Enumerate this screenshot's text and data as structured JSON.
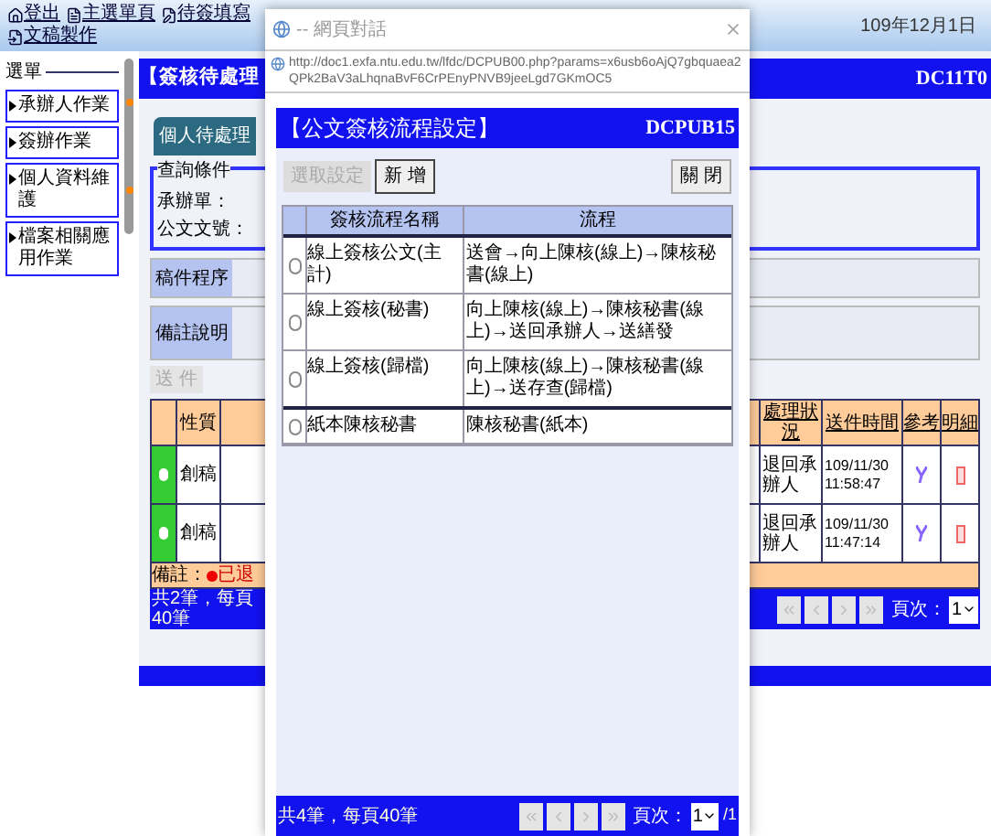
{
  "top_nav": {
    "links": [
      {
        "label": "登出"
      },
      {
        "label": "主選單頁"
      },
      {
        "label": "待簽填寫"
      },
      {
        "label": "文稿製作"
      }
    ],
    "date": "109年12月1日"
  },
  "sidebar": {
    "title": "選單",
    "items": [
      {
        "label": "承辦人作業"
      },
      {
        "label": "簽辦作業"
      },
      {
        "label": "個人資料維護"
      },
      {
        "label": "檔案相關應用作業"
      }
    ]
  },
  "page": {
    "title": "【簽核待處理",
    "code": "DC11T0",
    "tabs": [
      {
        "label": "個人待處理",
        "selected": true
      }
    ],
    "query": {
      "legend": "查詢條件",
      "fields": [
        {
          "label": "承辦單："
        },
        {
          "label": "公文文號："
        }
      ]
    },
    "sort_label": "稿件程序",
    "remark_label": "備註說明",
    "buttons": [
      {
        "label": "送 件"
      }
    ],
    "table": {
      "columns_left": [
        "性質"
      ],
      "columns_right": [
        "處理狀況",
        "送件時間",
        "參考",
        "明細"
      ],
      "rows": [
        {
          "nature": "創稿",
          "status": "退回承辦人",
          "time": "109/11/30 11:58:47"
        },
        {
          "nature": "創稿",
          "status": "退回承辦人",
          "time": "109/11/30 11:47:14"
        }
      ]
    },
    "note": "備註：",
    "note_text": "已退",
    "pager": {
      "summary": "共2筆，每頁40筆",
      "page_label": "頁次：",
      "page": "1"
    }
  },
  "dialog": {
    "title": "-- 網頁對話",
    "url": "http://doc1.exfa.ntu.edu.tw/lfdc/DCPUB00.php?params=x6usb6oAjQ7gbquaea2QPk2BaV3aLhqnaBvF6CrPEnyPNVB9jeeLgd7GKmOC5",
    "heading": "【公文簽核流程設定】",
    "code": "DCPUB15",
    "buttons": [
      {
        "label": "選取設定",
        "disabled": true
      },
      {
        "label": "新 增",
        "disabled": false
      }
    ],
    "close_button": "關 閉",
    "columns": [
      "簽核流程名稱",
      "流程"
    ],
    "rows": [
      {
        "name": "線上簽核公文(主計)",
        "flow": "送會→向上陳核(線上)→陳核秘書(線上)",
        "selected": false
      },
      {
        "name": "線上簽核(秘書)",
        "flow": "向上陳核(線上)→陳核秘書(線上)→送回承辦人→送繕發",
        "selected": false
      },
      {
        "name": "線上簽核(歸檔)",
        "flow": "向上陳核(線上)→陳核秘書(線上)→送存查(歸檔)",
        "selected": false
      },
      {
        "name": "紙本陳核秘書",
        "flow": "陳核秘書(紙本)",
        "selected": false
      }
    ],
    "pager": {
      "summary": "共4筆，每頁40筆",
      "page_label": "頁次：",
      "page": "1",
      "total": "/1"
    }
  }
}
